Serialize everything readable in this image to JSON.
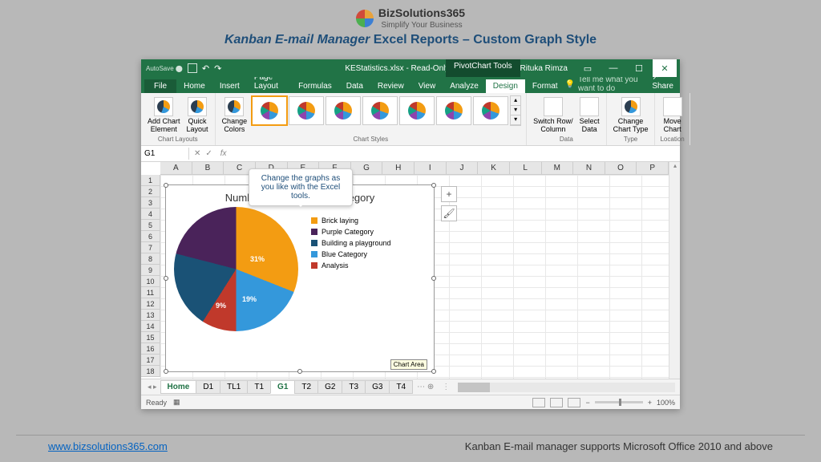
{
  "brand": {
    "name": "BizSolutions365",
    "tagline": "Simplify Your Business"
  },
  "slide": {
    "title_italic": "Kanban E-mail Manager",
    "title_rest": " Excel Reports – Custom Graph Style"
  },
  "window": {
    "filename": "KEStatistics.xlsx  -  Read-Only  -  Excel",
    "tools_tab": "PivotChart Tools",
    "user": "Rituka Rimza",
    "tell_me": "Tell me what you want to do",
    "share": "Share"
  },
  "ribbon_tabs": [
    "File",
    "Home",
    "Insert",
    "Page Layout",
    "Formulas",
    "Data",
    "Review",
    "View",
    "Analyze",
    "Design",
    "Format"
  ],
  "ribbon_active": "Design",
  "ribbon_groups": {
    "layouts": {
      "label": "Chart Layouts",
      "btns": [
        "Add Chart\nElement",
        "Quick\nLayout"
      ]
    },
    "styles": {
      "label": "Chart Styles",
      "change": "Change\nColors"
    },
    "data": {
      "label": "Data",
      "btns": [
        "Switch Row/\nColumn",
        "Select\nData"
      ]
    },
    "type": {
      "label": "Type",
      "btn": "Change\nChart Type"
    },
    "location": {
      "label": "Location",
      "btn": "Move\nChart"
    }
  },
  "namebox": "G1",
  "callout": "Change the graphs as you like with the Excel tools.",
  "columns": [
    "A",
    "B",
    "C",
    "D",
    "E",
    "F",
    "G",
    "H",
    "I",
    "J",
    "K",
    "L",
    "M",
    "N",
    "O",
    "P"
  ],
  "rows": 18,
  "chart_data": {
    "type": "pie",
    "title": "Number of E-mails per Category",
    "series": [
      {
        "name": "Brick laying",
        "value": 31,
        "color": "#f39c12"
      },
      {
        "name": "Purple Category",
        "value": 21,
        "color": "#4a235a"
      },
      {
        "name": "Building a playground",
        "value": 20,
        "color": "#1a5276"
      },
      {
        "name": "Blue Category",
        "value": 19,
        "color": "#3498db"
      },
      {
        "name": "Analysis",
        "value": 9,
        "color": "#c0392b"
      }
    ],
    "visible_labels": {
      "31": "31%",
      "19": "19%",
      "9": "9%"
    }
  },
  "chart_tooltip": "Chart Area",
  "sheet_tabs": [
    "Home",
    "D1",
    "TL1",
    "T1",
    "G1",
    "T2",
    "G2",
    "T3",
    "G3",
    "T4"
  ],
  "sheet_active": "G1",
  "status": {
    "ready": "Ready",
    "zoom": "100%"
  },
  "footer": {
    "url": "www.bizsolutions365.com",
    "text": "Kanban E-mail manager supports Microsoft Office 2010 and above"
  }
}
